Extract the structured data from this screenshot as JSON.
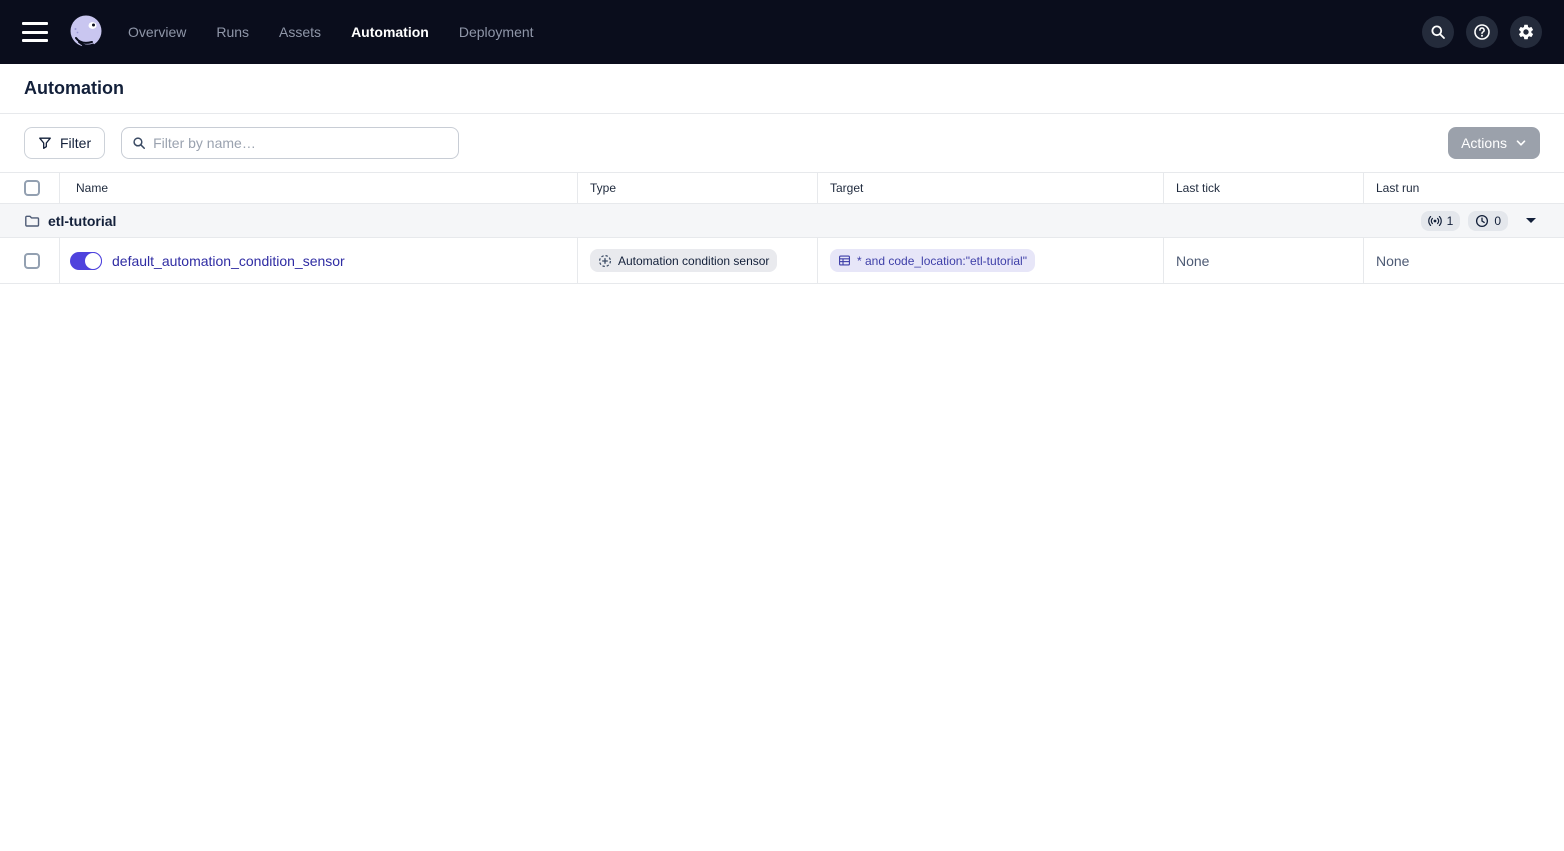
{
  "navbar": {
    "links": [
      {
        "label": "Overview"
      },
      {
        "label": "Runs"
      },
      {
        "label": "Assets"
      },
      {
        "label": "Automation"
      },
      {
        "label": "Deployment"
      }
    ],
    "action_icons": [
      "search-icon",
      "help-icon",
      "settings-icon"
    ]
  },
  "page": {
    "title": "Automation"
  },
  "toolbar": {
    "filter_button_label": "Filter",
    "search_placeholder": "Filter by name…",
    "search_value": "",
    "actions_button_label": "Actions"
  },
  "table": {
    "columns": {
      "name": "Name",
      "type": "Type",
      "target": "Target",
      "last_tick": "Last tick",
      "last_run": "Last run"
    },
    "group": {
      "name": "etl-tutorial",
      "sensor_count": "1",
      "schedule_count": "0"
    },
    "rows": [
      {
        "enabled": true,
        "name": "default_automation_condition_sensor",
        "type": "Automation condition sensor",
        "target": "* and code_location:\"etl-tutorial\"",
        "last_tick": "None",
        "last_run": "None"
      }
    ]
  },
  "colors": {
    "navbar_bg": "#0A0D1C",
    "accent": "#4F43DD",
    "link": "#2F2CA3",
    "row_alt_bg": "#F5F6F8",
    "border": "#E7E9EC",
    "target_pill_bg": "#E7E6F8",
    "target_pill_text": "#3E3FA8",
    "actions_bg": "#9BA1AB"
  }
}
